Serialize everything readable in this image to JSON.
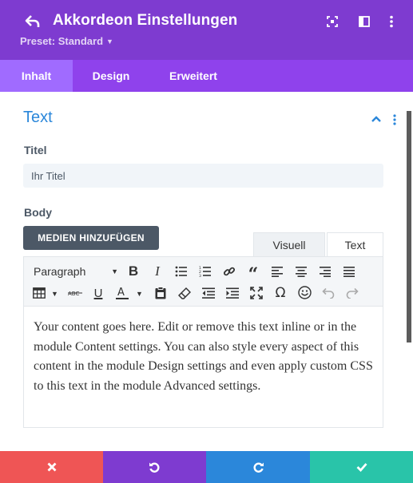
{
  "header": {
    "title": "Akkordeon Einstellungen",
    "preset_label": "Preset: Standard",
    "background": "#7e3bd0",
    "icons": [
      "back-arrow-icon",
      "focus-icon",
      "sidebar-layout-icon",
      "more-vertical-icon"
    ]
  },
  "tabs": [
    {
      "label": "Inhalt",
      "active": true
    },
    {
      "label": "Design",
      "active": false
    },
    {
      "label": "Erweitert",
      "active": false
    }
  ],
  "section": {
    "title": "Text",
    "title_color": "#2b87da"
  },
  "fields": {
    "titel_label": "Titel",
    "titel_value": "Ihr Titel",
    "body_label": "Body"
  },
  "editor": {
    "media_button": "MEDIEN HINZUFÜGEN",
    "tab_visual": "Visuell",
    "tab_text": "Text",
    "format_select": "Paragraph",
    "toolbar_icons": [
      "bold-icon",
      "italic-icon",
      "bullet-list-icon",
      "numbered-list-icon",
      "link-icon",
      "blockquote-icon",
      "align-left-icon",
      "align-center-icon",
      "align-right-icon",
      "align-justify-icon",
      "table-icon",
      "strikethrough-icon",
      "underline-icon",
      "text-color-icon",
      "paste-icon",
      "eraser-icon",
      "outdent-icon",
      "indent-icon",
      "fullscreen-icon",
      "omega-icon",
      "emoji-icon",
      "undo-icon",
      "redo-icon"
    ],
    "content": "Your content goes here. Edit or remove this text inline or in the module Content settings. You can also style every aspect of this content in the module Design settings and even apply custom CSS to this text in the module Advanced settings."
  },
  "footer": {
    "buttons": [
      {
        "name": "cancel",
        "icon": "close-icon",
        "color": "#ef5555"
      },
      {
        "name": "undo",
        "icon": "undo-icon",
        "color": "#7e3bd0"
      },
      {
        "name": "redo",
        "icon": "redo-icon",
        "color": "#2b87da"
      },
      {
        "name": "save",
        "icon": "check-icon",
        "color": "#29c4a9"
      }
    ]
  }
}
